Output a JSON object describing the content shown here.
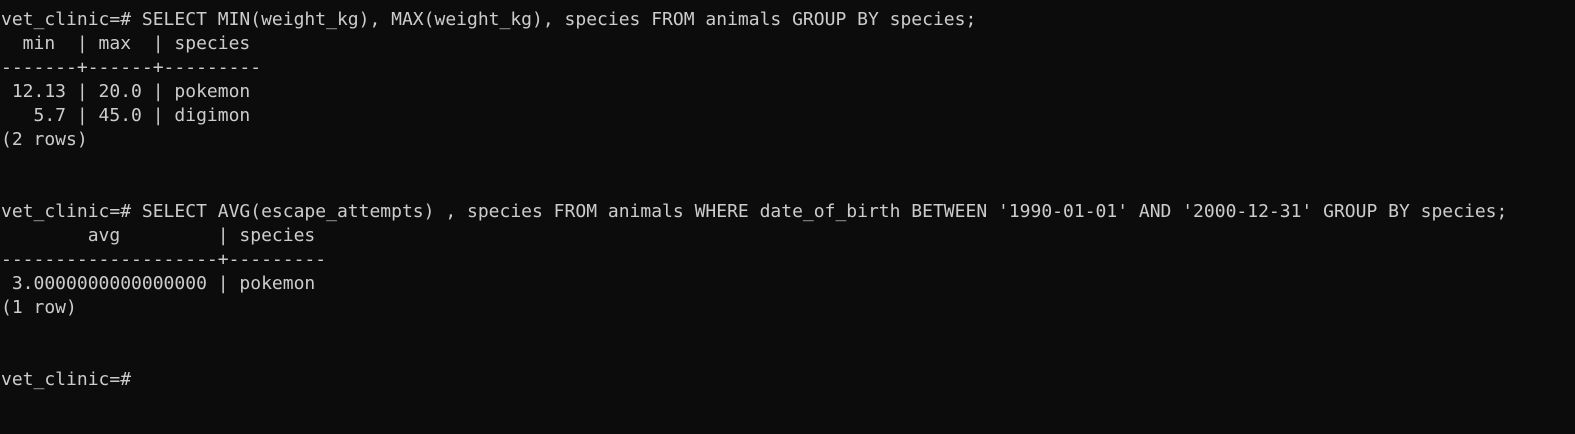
{
  "terminal": {
    "lines": [
      "vet_clinic=# SELECT MIN(weight_kg), MAX(weight_kg), species FROM animals GROUP BY species;",
      "  min  | max  | species",
      "-------+------+---------",
      " 12.13 | 20.0 | pokemon",
      "   5.7 | 45.0 | digimon",
      "(2 rows)",
      "",
      "",
      "vet_clinic=# SELECT AVG(escape_attempts) , species FROM animals WHERE date_of_birth BETWEEN '1990-01-01' AND '2000-12-31' GROUP BY species;",
      "        avg         | species",
      "--------------------+---------",
      " 3.0000000000000000 | pokemon",
      "(1 row)",
      "",
      "",
      "vet_clinic=#"
    ]
  }
}
